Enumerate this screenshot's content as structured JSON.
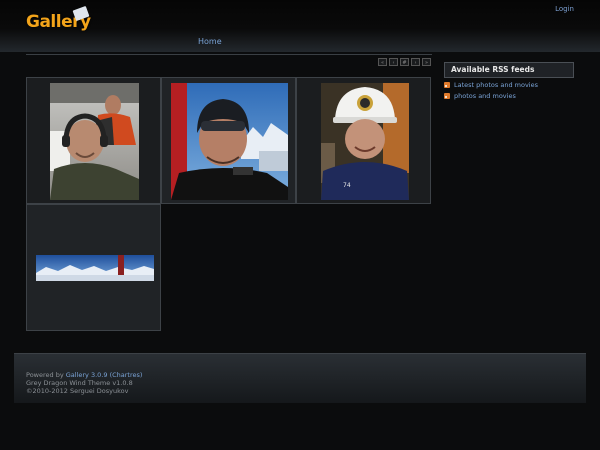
{
  "header": {
    "logo_text": "Gallery",
    "login_label": "Login"
  },
  "nav": {
    "home_label": "Home"
  },
  "pager": {
    "buttons": [
      "«",
      "‹",
      "#",
      "›",
      "»"
    ]
  },
  "sidebar": {
    "title": "Available RSS feeds",
    "feeds": [
      "Latest photos and movies",
      "photos and movies"
    ]
  },
  "footer": {
    "powered_prefix": "Powered by ",
    "powered_link": "Gallery 3.0.9 (Chartres)",
    "theme_line": "Grey Dragon Wind Theme v1.0.8",
    "copyright_line": "©2010-2012 Serguei Dosyukov"
  }
}
